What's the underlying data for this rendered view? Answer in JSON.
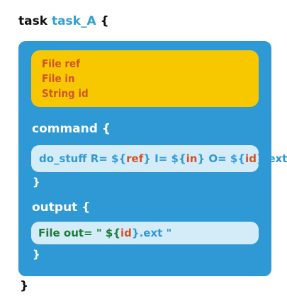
{
  "header": {
    "keyword": "task",
    "name": "task_A",
    "open": "{"
  },
  "inputs": [
    "File ref",
    "File in",
    "String id"
  ],
  "command": {
    "label": "command {",
    "parts": [
      "do_stuff R= ${",
      "ref",
      "} I= ${",
      "in",
      "} O= ${",
      "id",
      "}.ext"
    ],
    "close": "}"
  },
  "output": {
    "label": "output {",
    "decl": "File out=",
    "parts": [
      " \" ${",
      "id",
      "}.ext \""
    ],
    "close": "}"
  },
  "closing": "}",
  "colors": {
    "panel": "#2f99d6",
    "inputs_box": "#f7c800",
    "pill": "#d4ecf8",
    "variable": "#d2522a",
    "output_decl": "#1f7a3a"
  }
}
